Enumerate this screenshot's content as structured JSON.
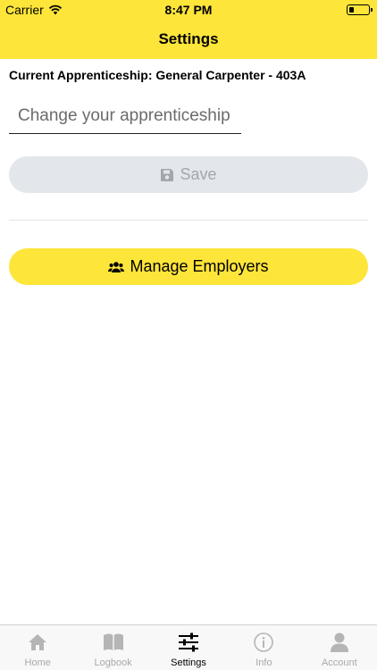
{
  "status_bar": {
    "carrier": "Carrier",
    "time": "8:47 PM"
  },
  "nav": {
    "title": "Settings"
  },
  "settings": {
    "current_label": "Current Apprenticeship: General Carpenter - 403A",
    "apprenticeship_placeholder": "Change your apprenticeship",
    "save_label": "Save",
    "manage_employers_label": "Manage Employers"
  },
  "tab_bar": {
    "items": [
      {
        "label": "Home",
        "icon": "home-icon",
        "active": false
      },
      {
        "label": "Logbook",
        "icon": "book-icon",
        "active": false
      },
      {
        "label": "Settings",
        "icon": "sliders-icon",
        "active": true
      },
      {
        "label": "Info",
        "icon": "info-icon",
        "active": false
      },
      {
        "label": "Account",
        "icon": "user-icon",
        "active": false
      }
    ]
  },
  "colors": {
    "accent": "#fde53a",
    "disabled_button": "#e3e6ea",
    "disabled_text": "#a3a7ad",
    "inactive_tab": "#a9a9a9"
  }
}
